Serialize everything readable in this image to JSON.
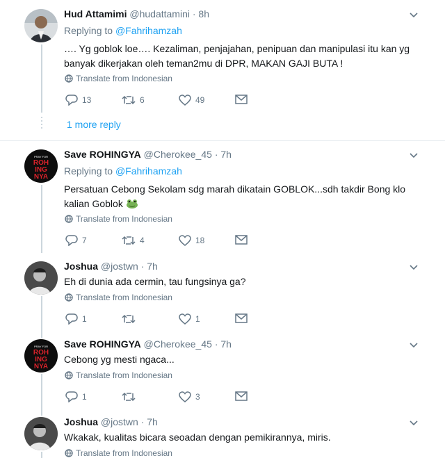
{
  "tweets": [
    {
      "name": "Hud Attamimi",
      "handle": "@hudattamini",
      "time": "· 8h",
      "replying_prefix": "Replying to ",
      "replying_to": "@Fahrihamzah",
      "text_lines": [
        "…. Yg goblok loe…. Kezaliman,  penjajahan, penipuan dan manipulasi itu kan yg",
        "banyak dikerjakan oleh teman2mu di DPR,  MAKAN GAJI BUTA !"
      ],
      "translate": "Translate from Indonesian",
      "replies": "13",
      "retweets": "6",
      "likes": "49"
    },
    {
      "name": "Save ROHINGYA",
      "handle": "@Cherokee_45",
      "time": "· 7h",
      "replying_prefix": "Replying to ",
      "replying_to": "@Fahrihamzah",
      "text_lines": [
        "Persatuan Cebong Sekolam sdg marah dikatain GOBLOK...sdh takdir Bong klo",
        "kalian Goblok"
      ],
      "translate": "Translate from Indonesian",
      "replies": "7",
      "retweets": "4",
      "likes": "18"
    },
    {
      "name": "Joshua",
      "handle": "@jostwn",
      "time": "· 7h",
      "text_lines": [
        "Eh di dunia ada cermin, tau fungsinya ga?"
      ],
      "translate": "Translate from Indonesian",
      "replies": "1",
      "retweets": "",
      "likes": "1"
    },
    {
      "name": "Save ROHINGYA",
      "handle": "@Cherokee_45",
      "time": "· 7h",
      "text_lines": [
        "Cebong yg mesti ngaca..."
      ],
      "translate": "Translate from Indonesian",
      "replies": "1",
      "retweets": "",
      "likes": "3"
    },
    {
      "name": "Joshua",
      "handle": "@jostwn",
      "time": "· 7h",
      "text_lines": [
        "Wkakak, kualitas bicara seoadan dengan pemikirannya, miris."
      ],
      "translate": "Translate from Indonesian"
    }
  ],
  "more_replies": "1 more reply",
  "avatar_text": {
    "top": "PRAY FOR",
    "line1": "ROH",
    "line2": "ING",
    "line3": "NYA"
  },
  "colors": {
    "link": "#1da1f2",
    "muted": "#657786",
    "line": "#ccd6dd"
  }
}
